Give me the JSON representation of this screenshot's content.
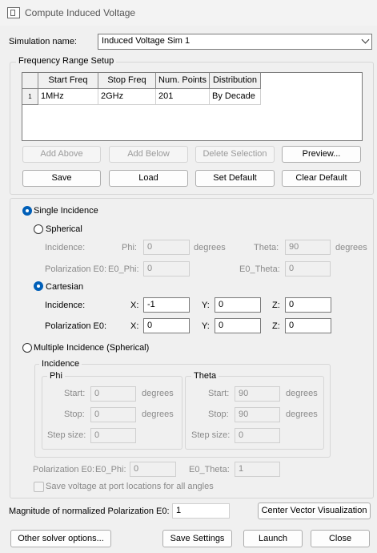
{
  "window": {
    "title": "Compute Induced Voltage"
  },
  "sim": {
    "label": "Simulation name:",
    "value": "Induced Voltage Sim 1"
  },
  "freq": {
    "title": "Frequency Range Setup",
    "columns": [
      "Start Freq",
      "Stop Freq",
      "Num. Points",
      "Distribution"
    ],
    "rows": [
      {
        "num": "1",
        "cells": [
          "1MHz",
          "2GHz",
          "201",
          "By Decade"
        ]
      }
    ],
    "buttons": {
      "add_above": "Add Above",
      "add_below": "Add Below",
      "delete": "Delete Selection",
      "preview": "Preview...",
      "save": "Save",
      "load": "Load",
      "set_default": "Set Default",
      "clear_default": "Clear Default"
    }
  },
  "single": {
    "label": "Single Incidence",
    "spherical": {
      "label": "Spherical",
      "incidence": "Incidence:",
      "phi": "Phi:",
      "phi_val": "0",
      "deg": "degrees",
      "theta": "Theta:",
      "theta_val": "90",
      "pol": "Polarization E0:",
      "e0phi": "E0_Phi:",
      "e0phi_val": "0",
      "e0theta": "E0_Theta:",
      "e0theta_val": "0"
    },
    "cartesian": {
      "label": "Cartesian",
      "incidence": "Incidence:",
      "pol": "Polarization E0:",
      "x": "X:",
      "y": "Y:",
      "z": "Z:",
      "inc_x": "-1",
      "inc_y": "0",
      "inc_z": "0",
      "pol_x": "0",
      "pol_y": "0",
      "pol_z": "0"
    }
  },
  "multiple": {
    "label": "Multiple Incidence (Spherical)",
    "incidence": "Incidence",
    "phi": {
      "title": "Phi",
      "start": "Start:",
      "start_val": "0",
      "stop": "Stop:",
      "stop_val": "0",
      "step": "Step size:",
      "step_val": "0",
      "deg": "degrees"
    },
    "theta": {
      "title": "Theta",
      "start": "Start:",
      "start_val": "90",
      "stop": "Stop:",
      "stop_val": "90",
      "step": "Step size:",
      "step_val": "0",
      "deg": "degrees"
    },
    "pol": "Polarization E0:",
    "e0phi": "E0_Phi:",
    "e0phi_val": "0",
    "e0theta": "E0_Theta:",
    "e0theta_val": "1",
    "save_voltage": "Save voltage at port locations for all angles"
  },
  "magnitude": {
    "label": "Magnitude of normalized Polarization E0:",
    "value": "1",
    "center_btn": "Center Vector Visualization"
  },
  "footer": {
    "other": "Other solver options...",
    "save_settings": "Save Settings",
    "launch": "Launch",
    "close": "Close"
  },
  "colors": {
    "accent": "#005fb8",
    "background": "#f0f0f0"
  }
}
